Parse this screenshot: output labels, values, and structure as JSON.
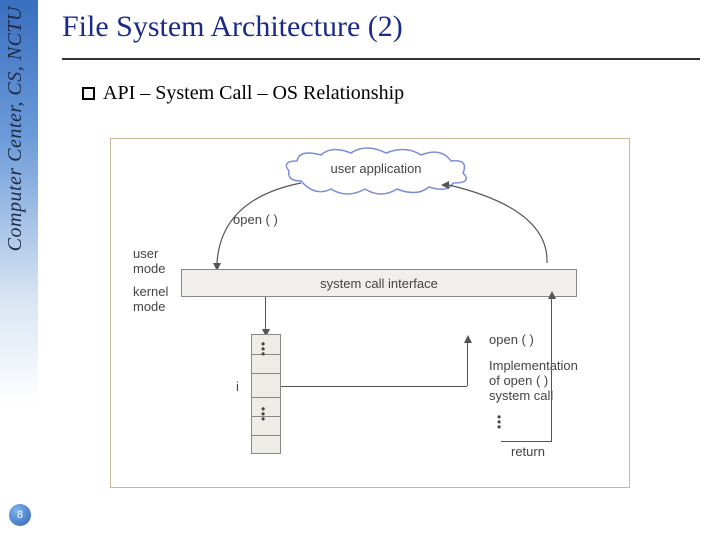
{
  "sidebar": {
    "org": "Computer Center, CS, NCTU"
  },
  "page": {
    "number": "8"
  },
  "title": "File System Architecture (2)",
  "bullet": {
    "text": "API – System Call – OS Relationship"
  },
  "figure": {
    "cloud": "user application",
    "open_left": "open ( )",
    "user_mode": "user\nmode",
    "kernel_mode": "kernel\nmode",
    "sci": "system call interface",
    "i_label": "i",
    "open_right": "open ( )",
    "impl": "Implementation\nof open ( )\nsystem call",
    "return": "return"
  }
}
